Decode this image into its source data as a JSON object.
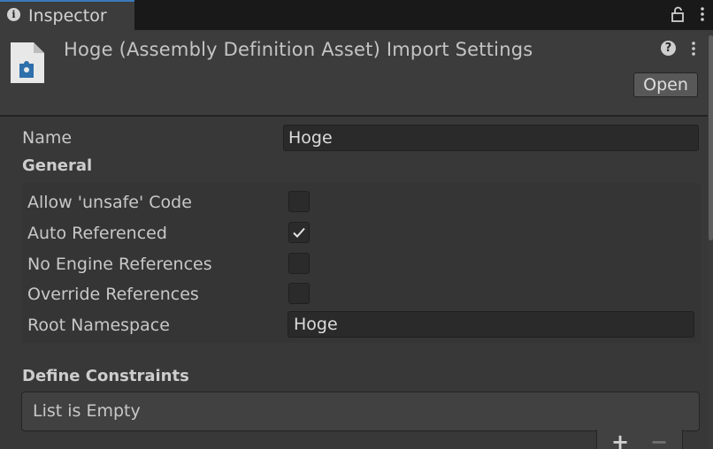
{
  "tab": {
    "label": "Inspector",
    "info_icon": "info-icon",
    "info_glyph": "i"
  },
  "header": {
    "title": "Hoge (Assembly Definition Asset) Import Settings",
    "open_label": "Open",
    "help_glyph": "?",
    "asset_icon": "assembly-definition-icon"
  },
  "fields": {
    "name_label": "Name",
    "name_value": "Hoge"
  },
  "general": {
    "heading": "General",
    "rows": [
      {
        "label": "Allow 'unsafe' Code",
        "checked": false
      },
      {
        "label": "Auto Referenced",
        "checked": true
      },
      {
        "label": "No Engine References",
        "checked": false
      },
      {
        "label": "Override References",
        "checked": false
      }
    ],
    "root_namespace_label": "Root Namespace",
    "root_namespace_value": "Hoge"
  },
  "define_constraints": {
    "heading": "Define Constraints",
    "empty_text": "List is Empty",
    "add_glyph": "+",
    "remove_glyph": "−"
  },
  "colors": {
    "background": "#383838",
    "tab_accent": "#3a79bb",
    "field_bg": "#2a2a2a"
  }
}
